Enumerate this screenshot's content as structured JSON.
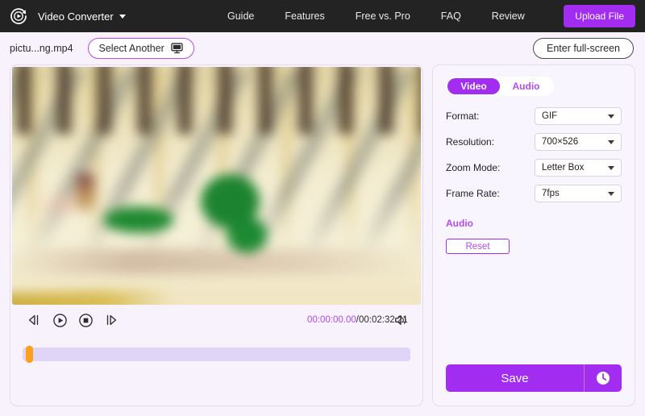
{
  "topbar": {
    "logo_icon": "play-circle-refresh-icon",
    "brand": "Video Converter",
    "brand_caret_icon": "chevron-down-icon",
    "nav": [
      {
        "label": "Guide"
      },
      {
        "label": "Features"
      },
      {
        "label": "Free vs. Pro"
      },
      {
        "label": "FAQ"
      },
      {
        "label": "Review"
      }
    ],
    "upload_label": "Upload File",
    "accent": "#a22cf0",
    "background": "#232323"
  },
  "filebar": {
    "filename": "pictu...ng.mp4",
    "select_another_label": "Select Another",
    "select_another_icon": "monitor-icon",
    "fullscreen_label": "Enter full-screen"
  },
  "player": {
    "controls": [
      {
        "name": "step-backward-button",
        "icon": "step-backward-icon"
      },
      {
        "name": "play-button",
        "icon": "play-circle-icon"
      },
      {
        "name": "stop-button",
        "icon": "stop-circle-icon"
      },
      {
        "name": "step-forward-button",
        "icon": "step-forward-icon"
      }
    ],
    "current_time": "00:00:00.00",
    "separator": "/",
    "total_time": "00:02:32.21",
    "volume_icon": "speaker-icon",
    "timeline_handle_color": "#f9a11b",
    "timeline_track_color": "#e0d4f7",
    "timeline_position_percent": 1
  },
  "settings": {
    "tabs": [
      {
        "label": "Video",
        "active": true
      },
      {
        "label": "Audio",
        "active": false
      }
    ],
    "rows": [
      {
        "label": "Format:",
        "value": "GIF"
      },
      {
        "label": "Resolution:",
        "value": "700×526"
      },
      {
        "label": "Zoom Mode:",
        "value": "Letter Box"
      },
      {
        "label": "Frame Rate:",
        "value": "7fps"
      }
    ],
    "audio_heading": "Audio",
    "reset_label": "Reset",
    "save_label": "Save",
    "history_icon": "clock-icon"
  }
}
